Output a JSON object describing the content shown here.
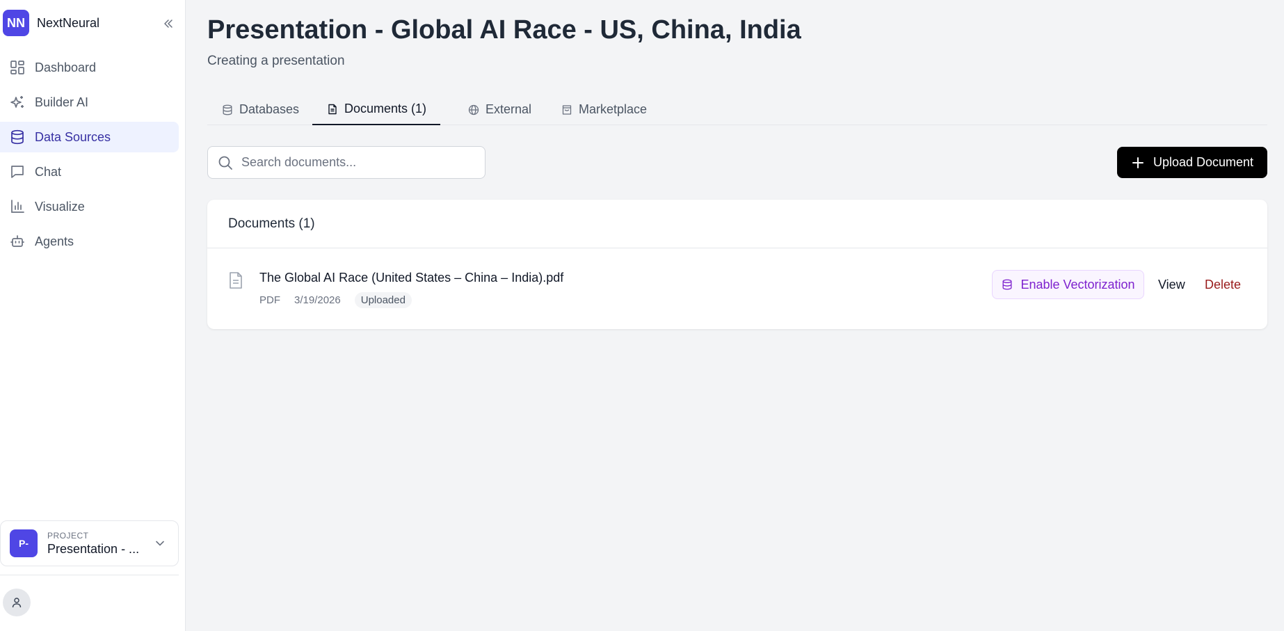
{
  "brand": {
    "logo_text": "NN",
    "name": "NextNeural"
  },
  "sidebar": {
    "items": [
      {
        "label": "Dashboard",
        "icon": "dashboard-icon"
      },
      {
        "label": "Builder AI",
        "icon": "sparkles-icon"
      },
      {
        "label": "Data Sources",
        "icon": "database-icon",
        "active": true
      },
      {
        "label": "Chat",
        "icon": "chat-icon"
      },
      {
        "label": "Visualize",
        "icon": "bar-chart-icon"
      },
      {
        "label": "Agents",
        "icon": "bot-icon"
      }
    ],
    "project": {
      "kicker": "PROJECT",
      "avatar_text": "P-",
      "name": "Presentation - ..."
    }
  },
  "header": {
    "title": "Presentation - Global AI Race - US, China, India",
    "subtitle": "Creating a presentation"
  },
  "tabs": [
    {
      "label": "Databases",
      "icon": "database-icon"
    },
    {
      "label": "Documents (1)",
      "icon": "document-icon",
      "active": true
    },
    {
      "label": "External",
      "icon": "globe-icon"
    },
    {
      "label": "Marketplace",
      "icon": "shopping-bag-icon"
    }
  ],
  "search": {
    "placeholder": "Search documents...",
    "value": ""
  },
  "toolbar": {
    "upload_label": "Upload Document"
  },
  "documents": {
    "header": "Documents (1)",
    "items": [
      {
        "name": "The Global AI Race (United States – China – India).pdf",
        "type": "PDF",
        "date": "3/19/2026",
        "status": "Uploaded",
        "actions": {
          "vectorize": "Enable Vectorization",
          "view": "View",
          "delete": "Delete"
        }
      }
    ]
  },
  "colors": {
    "accent": "#4f46e5",
    "active_nav_bg": "#eef2ff",
    "vector_purple": "#7e22ce",
    "delete_red": "#991b1b"
  }
}
